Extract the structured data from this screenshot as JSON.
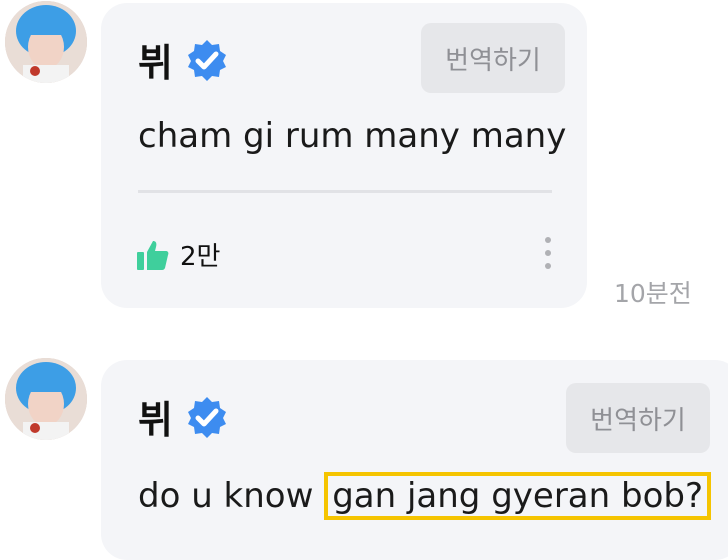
{
  "colors": {
    "bubble_bg": "#f4f5f8",
    "verified_blue": "#3d8cf0",
    "like_green": "#3fcf9c",
    "highlight_yellow": "#f5c400",
    "timestamp_gray": "#a4a5a9"
  },
  "posts": [
    {
      "author": "뷔",
      "verified_icon": "verified-check-badge",
      "translate_label": "번역하기",
      "message": "cham gi rum many many",
      "like_icon": "thumbs-up",
      "like_count": "2만",
      "more_icon": "vertical-dots",
      "timestamp": "10분전"
    },
    {
      "author": "뷔",
      "verified_icon": "verified-check-badge",
      "translate_label": "번역하기",
      "message_prefix": "do u know ",
      "message_highlight": "gan jang gyeran bob?"
    }
  ]
}
